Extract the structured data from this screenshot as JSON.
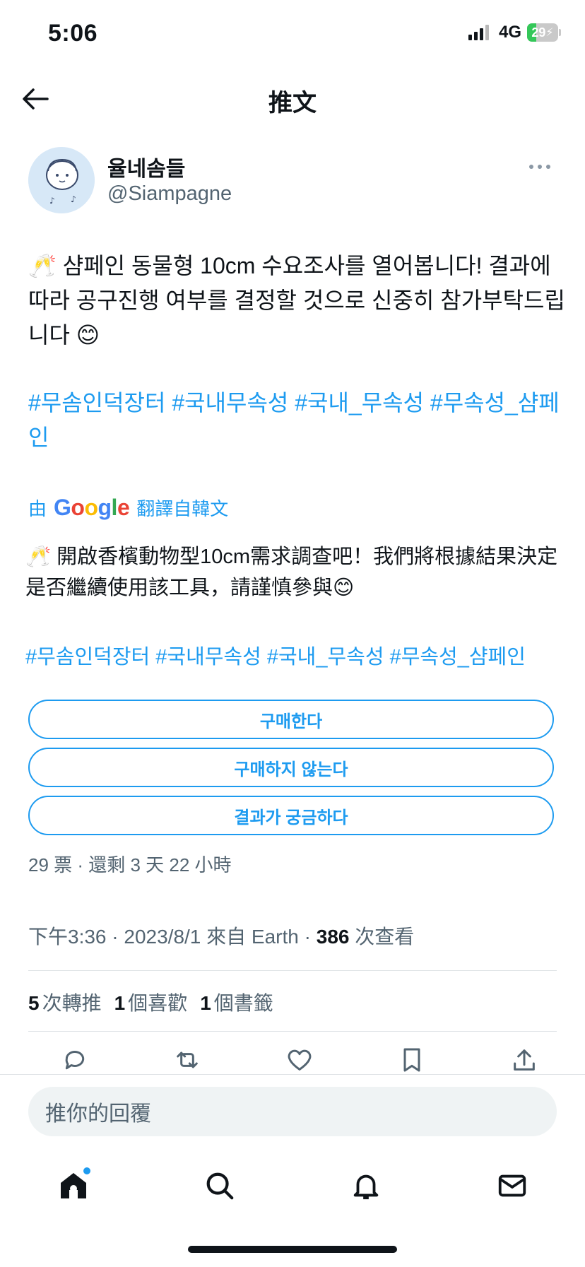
{
  "status_bar": {
    "time": "5:06",
    "network": "4G",
    "battery": "29",
    "battery_level": 0.29
  },
  "header": {
    "title": "推文"
  },
  "author": {
    "name": "율네솜들",
    "handle": "@Siampagne"
  },
  "tweet": {
    "emoji": "🥂",
    "text": "🥂 샴페인 동물형 10cm 수요조사를 열어봅니다! 결과에 따라 공구진행 여부를 결정할 것으로 신중히 참가부탁드립니다 😊",
    "hashtags": "#무솜인덕장터 #국내무속성 #국내_무속성 #무속성_샴페인"
  },
  "translation": {
    "prefix": "由",
    "google": "Google",
    "suffix": "翻譯自韓文",
    "text": "🥂 開啟香檳動物型10cm需求調查吧！我們將根據結果決定是否繼續使用該工具，請謹慎參與😊",
    "hashtags": "#무솜인덕장터 #국내무속성 #국내_무속성 #무속성_샴페인"
  },
  "poll": {
    "options": [
      "구매한다",
      "구매하지 않는다",
      "결과가 궁금하다"
    ],
    "meta": "29 票 · 還剩 3 天 22 小時"
  },
  "meta": {
    "time": "下午3:36 · 2023/8/1 來自 Earth · ",
    "views": "386",
    "views_label": " 次查看"
  },
  "stats": {
    "retweets": "5",
    "retweets_label": "次轉推",
    "likes": "1",
    "likes_label": "個喜歡",
    "bookmarks": "1",
    "bookmarks_label": "個書籤"
  },
  "reply": {
    "placeholder": "推你的回覆"
  },
  "colors": {
    "accent": "#1d9bf0",
    "secondary_text": "#536471",
    "text": "#0f1419"
  }
}
